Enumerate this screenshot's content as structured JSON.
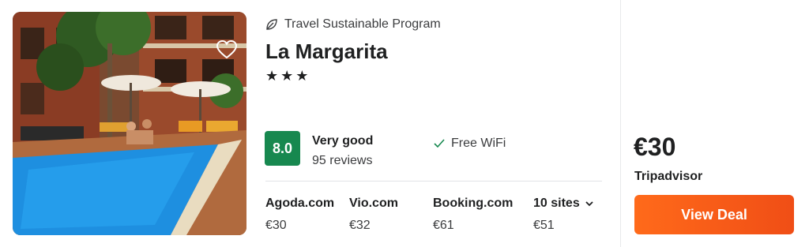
{
  "hotel": {
    "program": "Travel Sustainable Program",
    "name": "La Margarita",
    "stars": "★★★",
    "rating_score": "8.0",
    "rating_label": "Very good",
    "reviews": "95 reviews",
    "amenity": "Free WiFi"
  },
  "providers": [
    {
      "name": "Agoda.com",
      "price": "€30"
    },
    {
      "name": "Vio.com",
      "price": "€32"
    },
    {
      "name": "Booking.com",
      "price": "€61"
    },
    {
      "name": "10 sites",
      "price": "€51"
    }
  ],
  "best_deal": {
    "price": "€30",
    "site": "Tripadvisor",
    "button": "View Deal"
  },
  "colors": {
    "rating_green": "#17884f",
    "deal_orange": "#ff6a1a"
  },
  "icons": [
    "leaf-icon",
    "heart-icon",
    "check-icon",
    "chevron-down-icon"
  ]
}
